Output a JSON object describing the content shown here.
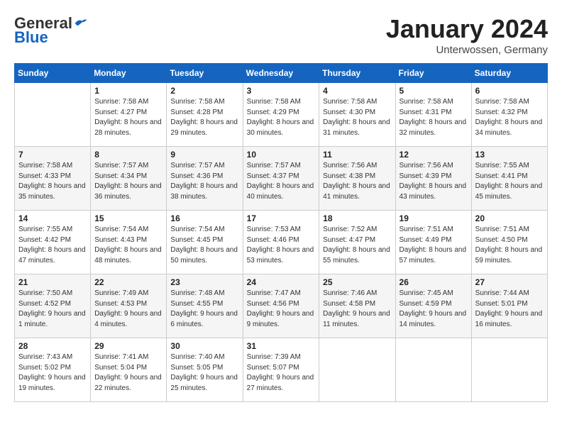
{
  "header": {
    "logo": {
      "general": "General",
      "blue": "Blue"
    },
    "title": "January 2024",
    "subtitle": "Unterwossen, Germany"
  },
  "calendar": {
    "days_of_week": [
      "Sunday",
      "Monday",
      "Tuesday",
      "Wednesday",
      "Thursday",
      "Friday",
      "Saturday"
    ],
    "weeks": [
      [
        {
          "day": "",
          "sunrise": "",
          "sunset": "",
          "daylight": ""
        },
        {
          "day": "1",
          "sunrise": "Sunrise: 7:58 AM",
          "sunset": "Sunset: 4:27 PM",
          "daylight": "Daylight: 8 hours and 28 minutes."
        },
        {
          "day": "2",
          "sunrise": "Sunrise: 7:58 AM",
          "sunset": "Sunset: 4:28 PM",
          "daylight": "Daylight: 8 hours and 29 minutes."
        },
        {
          "day": "3",
          "sunrise": "Sunrise: 7:58 AM",
          "sunset": "Sunset: 4:29 PM",
          "daylight": "Daylight: 8 hours and 30 minutes."
        },
        {
          "day": "4",
          "sunrise": "Sunrise: 7:58 AM",
          "sunset": "Sunset: 4:30 PM",
          "daylight": "Daylight: 8 hours and 31 minutes."
        },
        {
          "day": "5",
          "sunrise": "Sunrise: 7:58 AM",
          "sunset": "Sunset: 4:31 PM",
          "daylight": "Daylight: 8 hours and 32 minutes."
        },
        {
          "day": "6",
          "sunrise": "Sunrise: 7:58 AM",
          "sunset": "Sunset: 4:32 PM",
          "daylight": "Daylight: 8 hours and 34 minutes."
        }
      ],
      [
        {
          "day": "7",
          "sunrise": "Sunrise: 7:58 AM",
          "sunset": "Sunset: 4:33 PM",
          "daylight": "Daylight: 8 hours and 35 minutes."
        },
        {
          "day": "8",
          "sunrise": "Sunrise: 7:57 AM",
          "sunset": "Sunset: 4:34 PM",
          "daylight": "Daylight: 8 hours and 36 minutes."
        },
        {
          "day": "9",
          "sunrise": "Sunrise: 7:57 AM",
          "sunset": "Sunset: 4:36 PM",
          "daylight": "Daylight: 8 hours and 38 minutes."
        },
        {
          "day": "10",
          "sunrise": "Sunrise: 7:57 AM",
          "sunset": "Sunset: 4:37 PM",
          "daylight": "Daylight: 8 hours and 40 minutes."
        },
        {
          "day": "11",
          "sunrise": "Sunrise: 7:56 AM",
          "sunset": "Sunset: 4:38 PM",
          "daylight": "Daylight: 8 hours and 41 minutes."
        },
        {
          "day": "12",
          "sunrise": "Sunrise: 7:56 AM",
          "sunset": "Sunset: 4:39 PM",
          "daylight": "Daylight: 8 hours and 43 minutes."
        },
        {
          "day": "13",
          "sunrise": "Sunrise: 7:55 AM",
          "sunset": "Sunset: 4:41 PM",
          "daylight": "Daylight: 8 hours and 45 minutes."
        }
      ],
      [
        {
          "day": "14",
          "sunrise": "Sunrise: 7:55 AM",
          "sunset": "Sunset: 4:42 PM",
          "daylight": "Daylight: 8 hours and 47 minutes."
        },
        {
          "day": "15",
          "sunrise": "Sunrise: 7:54 AM",
          "sunset": "Sunset: 4:43 PM",
          "daylight": "Daylight: 8 hours and 48 minutes."
        },
        {
          "day": "16",
          "sunrise": "Sunrise: 7:54 AM",
          "sunset": "Sunset: 4:45 PM",
          "daylight": "Daylight: 8 hours and 50 minutes."
        },
        {
          "day": "17",
          "sunrise": "Sunrise: 7:53 AM",
          "sunset": "Sunset: 4:46 PM",
          "daylight": "Daylight: 8 hours and 53 minutes."
        },
        {
          "day": "18",
          "sunrise": "Sunrise: 7:52 AM",
          "sunset": "Sunset: 4:47 PM",
          "daylight": "Daylight: 8 hours and 55 minutes."
        },
        {
          "day": "19",
          "sunrise": "Sunrise: 7:51 AM",
          "sunset": "Sunset: 4:49 PM",
          "daylight": "Daylight: 8 hours and 57 minutes."
        },
        {
          "day": "20",
          "sunrise": "Sunrise: 7:51 AM",
          "sunset": "Sunset: 4:50 PM",
          "daylight": "Daylight: 8 hours and 59 minutes."
        }
      ],
      [
        {
          "day": "21",
          "sunrise": "Sunrise: 7:50 AM",
          "sunset": "Sunset: 4:52 PM",
          "daylight": "Daylight: 9 hours and 1 minute."
        },
        {
          "day": "22",
          "sunrise": "Sunrise: 7:49 AM",
          "sunset": "Sunset: 4:53 PM",
          "daylight": "Daylight: 9 hours and 4 minutes."
        },
        {
          "day": "23",
          "sunrise": "Sunrise: 7:48 AM",
          "sunset": "Sunset: 4:55 PM",
          "daylight": "Daylight: 9 hours and 6 minutes."
        },
        {
          "day": "24",
          "sunrise": "Sunrise: 7:47 AM",
          "sunset": "Sunset: 4:56 PM",
          "daylight": "Daylight: 9 hours and 9 minutes."
        },
        {
          "day": "25",
          "sunrise": "Sunrise: 7:46 AM",
          "sunset": "Sunset: 4:58 PM",
          "daylight": "Daylight: 9 hours and 11 minutes."
        },
        {
          "day": "26",
          "sunrise": "Sunrise: 7:45 AM",
          "sunset": "Sunset: 4:59 PM",
          "daylight": "Daylight: 9 hours and 14 minutes."
        },
        {
          "day": "27",
          "sunrise": "Sunrise: 7:44 AM",
          "sunset": "Sunset: 5:01 PM",
          "daylight": "Daylight: 9 hours and 16 minutes."
        }
      ],
      [
        {
          "day": "28",
          "sunrise": "Sunrise: 7:43 AM",
          "sunset": "Sunset: 5:02 PM",
          "daylight": "Daylight: 9 hours and 19 minutes."
        },
        {
          "day": "29",
          "sunrise": "Sunrise: 7:41 AM",
          "sunset": "Sunset: 5:04 PM",
          "daylight": "Daylight: 9 hours and 22 minutes."
        },
        {
          "day": "30",
          "sunrise": "Sunrise: 7:40 AM",
          "sunset": "Sunset: 5:05 PM",
          "daylight": "Daylight: 9 hours and 25 minutes."
        },
        {
          "day": "31",
          "sunrise": "Sunrise: 7:39 AM",
          "sunset": "Sunset: 5:07 PM",
          "daylight": "Daylight: 9 hours and 27 minutes."
        },
        {
          "day": "",
          "sunrise": "",
          "sunset": "",
          "daylight": ""
        },
        {
          "day": "",
          "sunrise": "",
          "sunset": "",
          "daylight": ""
        },
        {
          "day": "",
          "sunrise": "",
          "sunset": "",
          "daylight": ""
        }
      ]
    ]
  }
}
